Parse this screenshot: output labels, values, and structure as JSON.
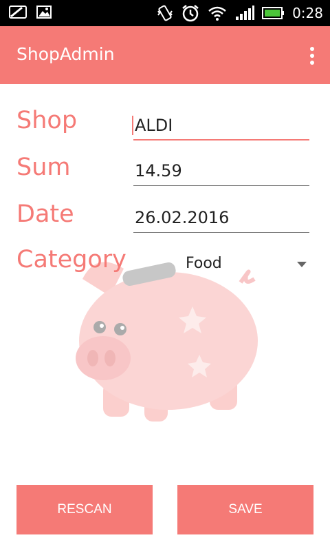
{
  "status_bar": {
    "left_icons": [
      "shop-notification-icon",
      "image-notification-icon"
    ],
    "right_icons": [
      "vibrate-icon",
      "alarm-icon",
      "wifi-icon",
      "signal-icon",
      "battery-icon"
    ],
    "time": "0:28"
  },
  "app_bar": {
    "title": "ShopAdmin",
    "overflow_icon": "more-vert-icon"
  },
  "form": {
    "shop": {
      "label": "Shop",
      "value": "ALDI"
    },
    "sum": {
      "label": "Sum",
      "value": "14.59"
    },
    "date": {
      "label": "Date",
      "value": "26.02.2016"
    },
    "category": {
      "label": "Category",
      "selected": "Food"
    }
  },
  "buttons": {
    "rescan": "RESCAN",
    "save": "SAVE"
  },
  "colors": {
    "accent": "#f57a76",
    "status_bar": "#000000",
    "background": "#ffffff"
  }
}
